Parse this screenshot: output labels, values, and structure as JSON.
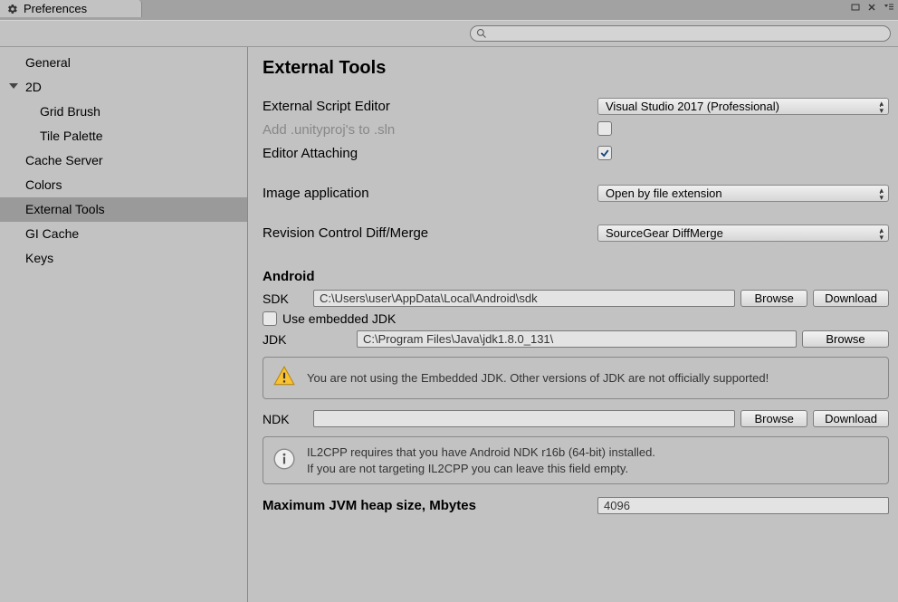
{
  "window": {
    "tab_title": "Preferences"
  },
  "search": {
    "value": ""
  },
  "sidebar": {
    "items": [
      {
        "label": "General",
        "level": 1
      },
      {
        "label": "2D",
        "level": 1,
        "expanded": true
      },
      {
        "label": "Grid Brush",
        "level": 2
      },
      {
        "label": "Tile Palette",
        "level": 2
      },
      {
        "label": "Cache Server",
        "level": 1
      },
      {
        "label": "Colors",
        "level": 1
      },
      {
        "label": "External Tools",
        "level": 1,
        "selected": true
      },
      {
        "label": "GI Cache",
        "level": 1
      },
      {
        "label": "Keys",
        "level": 1
      }
    ]
  },
  "page": {
    "title": "External Tools",
    "external_script_editor_label": "External Script Editor",
    "external_script_editor_value": "Visual Studio 2017 (Professional)",
    "add_unityproj_label": "Add .unityproj's to .sln",
    "add_unityproj_checked": false,
    "editor_attaching_label": "Editor Attaching",
    "editor_attaching_checked": true,
    "image_app_label": "Image application",
    "image_app_value": "Open by file extension",
    "revision_control_label": "Revision Control Diff/Merge",
    "revision_control_value": "SourceGear DiffMerge",
    "android_header": "Android",
    "sdk_label": "SDK",
    "sdk_value": "C:\\Users\\user\\AppData\\Local\\Android\\sdk",
    "browse_label": "Browse",
    "download_label": "Download",
    "use_embedded_jdk_label": "Use embedded JDK",
    "use_embedded_jdk_checked": false,
    "jdk_label": "JDK",
    "jdk_value": "C:\\Program Files\\Java\\jdk1.8.0_131\\",
    "jdk_warning": "You are not using the Embedded JDK. Other versions of JDK are not officially supported!",
    "ndk_label": "NDK",
    "ndk_value": "",
    "ndk_info_line1": "IL2CPP requires that you have Android NDK r16b (64-bit) installed.",
    "ndk_info_line2": "If you are not targeting IL2CPP you can leave this field empty.",
    "heap_label": "Maximum JVM heap size, Mbytes",
    "heap_value": "4096"
  }
}
